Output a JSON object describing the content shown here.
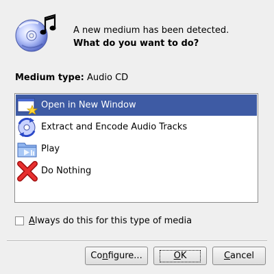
{
  "message": {
    "line1": "A new medium has been detected.",
    "line2": "What do you want to do?"
  },
  "medium": {
    "label": "Medium type:",
    "value": "Audio CD"
  },
  "actions": [
    {
      "label": "Open in New Window",
      "icon": "new-window-icon",
      "selected": true
    },
    {
      "label": "Extract and Encode Audio Tracks",
      "icon": "encode-audio-icon",
      "selected": false
    },
    {
      "label": "Play",
      "icon": "play-folder-icon",
      "selected": false
    },
    {
      "label": "Do Nothing",
      "icon": "red-x-icon",
      "selected": false
    }
  ],
  "always": {
    "label_first": "A",
    "label_rest": "lways do this for this type of media",
    "checked": false
  },
  "buttons": {
    "configure_pre": "Co",
    "configure_ul": "n",
    "configure_post": "figure...",
    "ok_ul": "O",
    "ok_rest": "K",
    "cancel_ul": "C",
    "cancel_rest": "ancel"
  },
  "colors": {
    "selection": "#3e5ba4",
    "background": "#efefef"
  }
}
